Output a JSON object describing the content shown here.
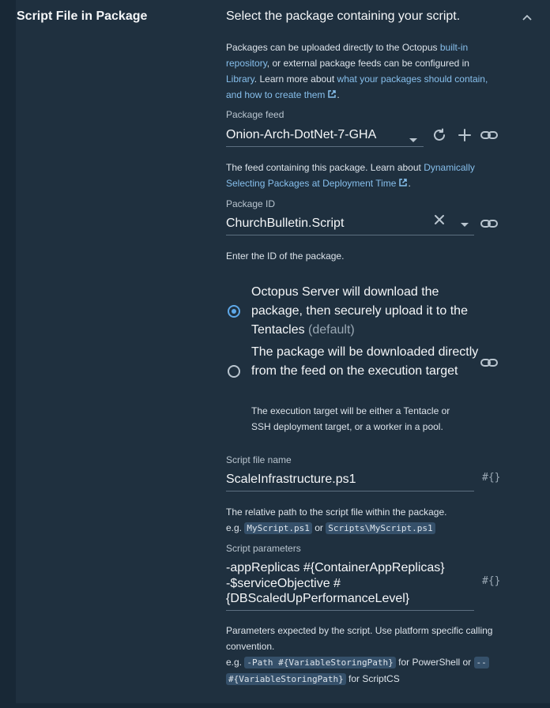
{
  "section": {
    "title": "Script File in Package",
    "summary": "Select the package containing your script."
  },
  "intro": {
    "t1": "Packages can be uploaded directly to the Octopus ",
    "link1": "built-in repository",
    "t2": ", or external package feeds can be configured in ",
    "link2": "Library",
    "t3": ". Learn more about ",
    "link3": "what your packages should contain, and how to create them",
    "t4": "."
  },
  "feed": {
    "label": "Package feed",
    "value": "Onion-Arch-DotNet-7-GHA",
    "help_text": "The feed containing this package. Learn about ",
    "help_link": "Dynamically Selecting Packages at Deployment Time",
    "help_end": "."
  },
  "package_id": {
    "label": "Package ID",
    "value": "ChurchBulletin.Script",
    "help": "Enter the ID of the package."
  },
  "acquisition": {
    "option1_main": "Octopus Server will download the package, then securely upload it to the Tentacles",
    "option1_default": "(default)",
    "option2_main": "The package will be downloaded directly from the feed on the execution target",
    "option2_help": "The execution target will be either a Tentacle or SSH deployment target, or a worker in a pool.",
    "selected": 0
  },
  "script_file": {
    "label": "Script file name",
    "value": "ScaleInfrastructure.ps1",
    "help": "The relative path to the script file within the package.",
    "eg": "e.g.",
    "example1": "MyScript.ps1",
    "or": "or",
    "example2": "Scripts\\MyScript.ps1"
  },
  "script_params": {
    "label": "Script parameters",
    "line1": "-appReplicas #{ContainerAppReplicas}",
    "line2": "-$serviceObjective #",
    "line3": "{DBScaledUpPerformanceLevel}",
    "help": "Parameters expected by the script. Use platform specific calling convention.",
    "eg": "e.g.",
    "example1": "-Path #{VariableStoringPath}",
    "for_ps": "for PowerShell or",
    "example2a": "--",
    "example2b": "#{VariableStoringPath}",
    "for_cs": "for ScriptCS"
  },
  "variable_insert_symbol": "#{}",
  "colors": {
    "background": "#1f303f",
    "link": "#87bfec",
    "accent": "#5ea8e8"
  }
}
